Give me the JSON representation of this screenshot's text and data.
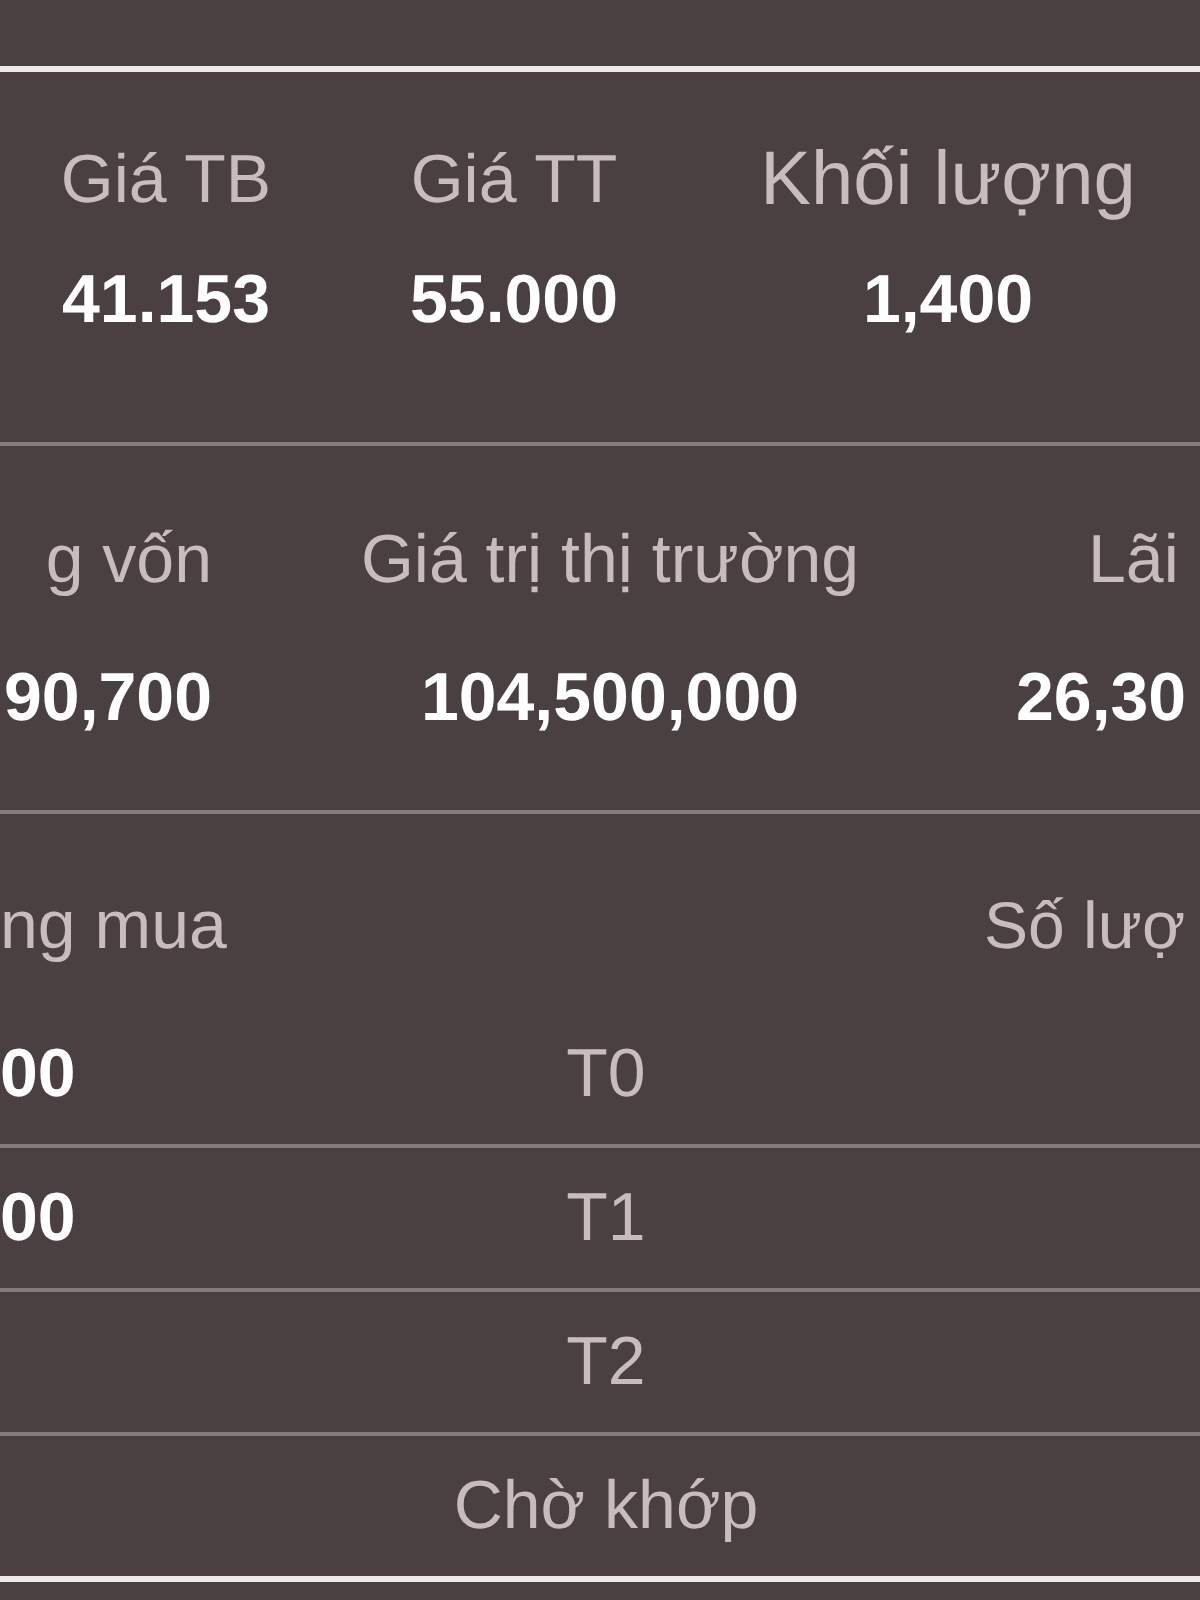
{
  "summary": {
    "items": [
      {
        "label": "Giá TB",
        "value": "41.153"
      },
      {
        "label": "Giá TT",
        "value": "55.000"
      },
      {
        "label": "Khối lượng",
        "value": "1,400"
      }
    ]
  },
  "totals": {
    "items": [
      {
        "label": "g vốn",
        "value": "90,700"
      },
      {
        "label": "Giá trị thị trường",
        "value": "104,500,000"
      },
      {
        "label": "Lãi",
        "value": "26,30"
      }
    ]
  },
  "table": {
    "columns": {
      "column_1": "ng mua",
      "column_3": "Số lượ"
    },
    "rows": [
      {
        "column_1": "00",
        "column_2": "T0"
      },
      {
        "column_1": "00",
        "column_2": "T1"
      },
      {
        "column_2": "T2"
      },
      {
        "column_2": "Chờ khớp"
      }
    ]
  }
}
